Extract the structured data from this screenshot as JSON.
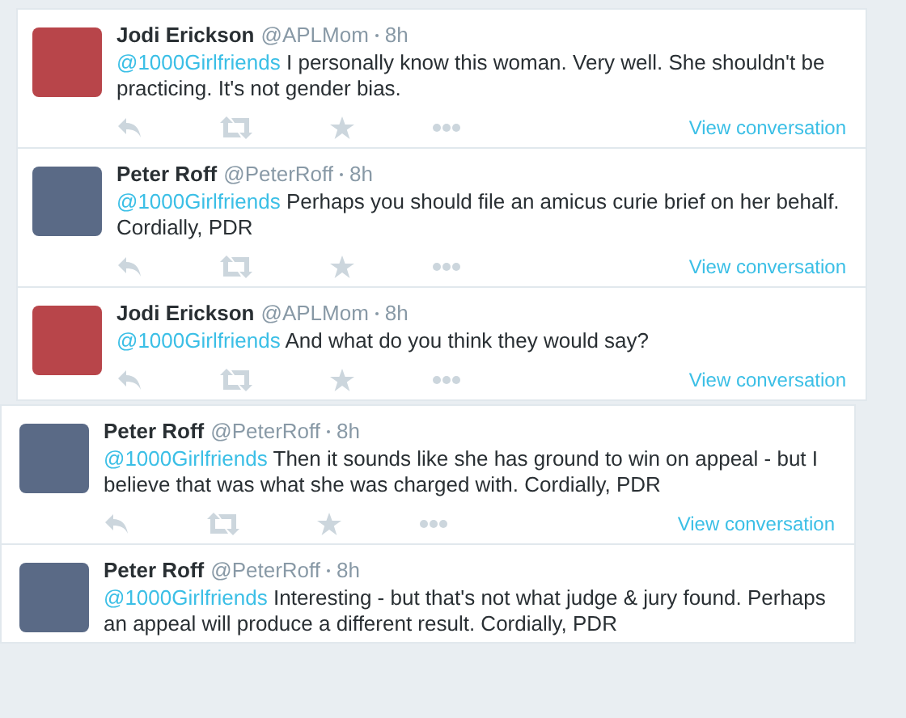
{
  "groups": [
    {
      "tweets": [
        {
          "name": "Jodi Erickson",
          "handle": "@APLMom",
          "time": "8h",
          "mention": "@1000Girlfriends",
          "text": "I personally know this woman. Very well. She shouldn't be practicing. It's not gender bias.",
          "link": "View conversation"
        },
        {
          "name": "Peter Roff",
          "handle": "@PeterRoff",
          "time": "8h",
          "mention": "@1000Girlfriends",
          "text": "Perhaps you should file an amicus curie brief on her behalf. Cordially, PDR",
          "link": "View conversation"
        },
        {
          "name": "Jodi Erickson",
          "handle": "@APLMom",
          "time": "8h",
          "mention": "@1000Girlfriends",
          "text": "And what do you think they would say?",
          "link": "View conversation"
        }
      ]
    },
    {
      "tweets": [
        {
          "name": "Peter Roff",
          "handle": "@PeterRoff",
          "time": "8h",
          "mention": "@1000Girlfriends",
          "text": "Then it sounds like she has ground to win on appeal - but I believe that was what she was charged with. Cordially, PDR",
          "link": "View conversation"
        },
        {
          "name": "Peter Roff",
          "handle": "@PeterRoff",
          "time": "8h",
          "mention": "@1000Girlfriends",
          "text": "Interesting - but that's not what judge & jury found. Perhaps an appeal will produce a different result. Cordially, PDR"
        }
      ]
    }
  ]
}
